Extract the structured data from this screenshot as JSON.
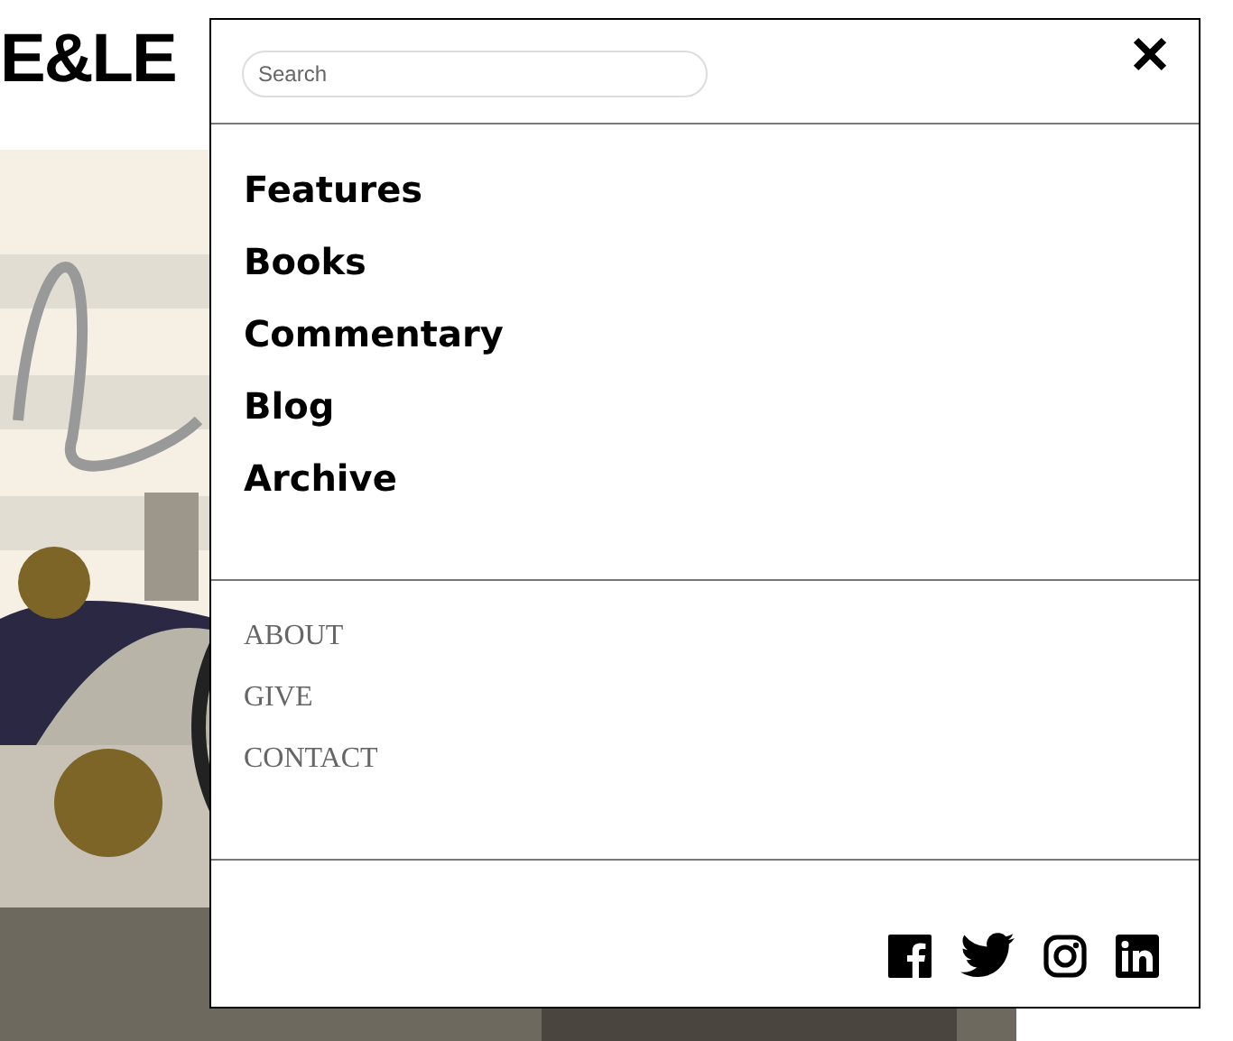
{
  "logo": "E&LE",
  "menu": {
    "search": {
      "placeholder": "Search"
    },
    "primary": [
      "Features",
      "Books",
      "Commentary",
      "Blog",
      "Archive"
    ],
    "secondary": [
      "ABOUT",
      "GIVE",
      "CONTACT"
    ],
    "social": [
      {
        "kind": "facebook"
      },
      {
        "kind": "twitter"
      },
      {
        "kind": "instagram"
      },
      {
        "kind": "linkedin"
      }
    ]
  }
}
